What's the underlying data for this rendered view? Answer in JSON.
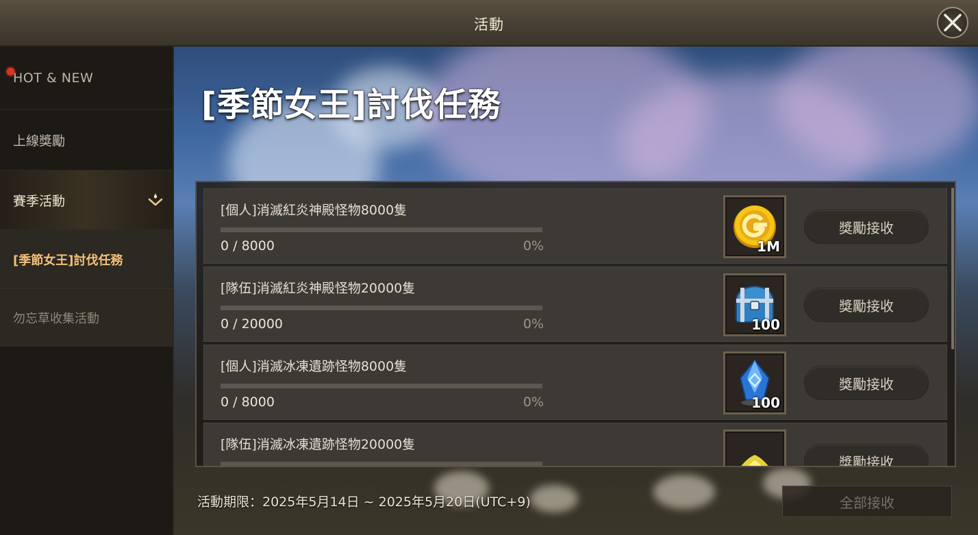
{
  "window": {
    "title": "活動"
  },
  "sidebar": {
    "items": [
      {
        "label": "HOT & NEW"
      },
      {
        "label": "上線獎勵",
        "has_notification": true
      },
      {
        "label": "賽季活動",
        "expanded": true
      },
      {
        "label": "[季節女王]討伐任務",
        "selected": true
      },
      {
        "label": "勿忘草收集活動"
      }
    ]
  },
  "event": {
    "title": "[季節女王]討伐任務",
    "tasks": [
      {
        "name": "[個人]消滅紅炎神殿怪物8000隻",
        "progress": "0 / 8000",
        "percent": "0%",
        "progress_fraction": 0,
        "reward_icon": "gold-coin-icon",
        "reward_qty": "1M",
        "claim_label": "獎勵接收"
      },
      {
        "name": "[隊伍]消滅紅炎神殿怪物20000隻",
        "progress": "0 / 20000",
        "percent": "0%",
        "progress_fraction": 0,
        "reward_icon": "treasure-chest-icon",
        "reward_qty": "100",
        "claim_label": "獎勵接收"
      },
      {
        "name": "[個人]消滅冰凍遺跡怪物8000隻",
        "progress": "0 / 8000",
        "percent": "0%",
        "progress_fraction": 0,
        "reward_icon": "blue-crystal-icon",
        "reward_qty": "100",
        "claim_label": "獎勵接收"
      },
      {
        "name": "[隊伍]消滅冰凍遺跡怪物20000隻",
        "progress": "",
        "percent": "",
        "progress_fraction": 0,
        "reward_icon": "gold-dust-icon",
        "reward_qty": "",
        "claim_label": "獎勵接收"
      }
    ],
    "period": "活動期限：2025年5月14日 ~ 2025年5月20日(UTC+9)",
    "claim_all_label": "全部接收"
  },
  "colors": {
    "accent_selected": "#f2c07a",
    "notification": "#e0321f",
    "progress_fill": "#d9a24a"
  }
}
